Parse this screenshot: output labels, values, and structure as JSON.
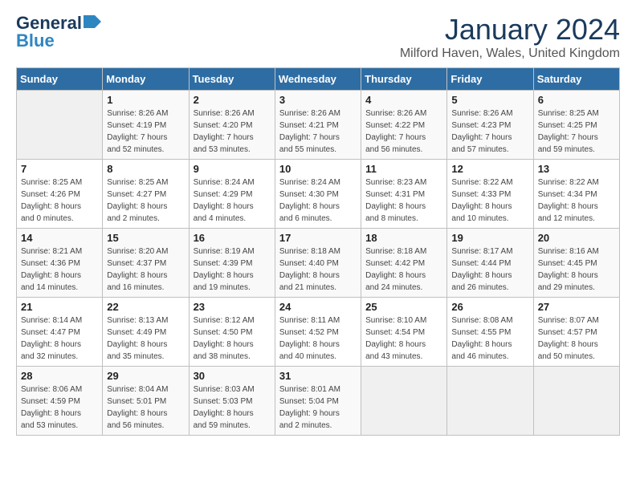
{
  "header": {
    "logo_line1": "General",
    "logo_line2": "Blue",
    "month": "January 2024",
    "location": "Milford Haven, Wales, United Kingdom"
  },
  "days_of_week": [
    "Sunday",
    "Monday",
    "Tuesday",
    "Wednesday",
    "Thursday",
    "Friday",
    "Saturday"
  ],
  "weeks": [
    [
      {
        "day": "",
        "info": ""
      },
      {
        "day": "1",
        "info": "Sunrise: 8:26 AM\nSunset: 4:19 PM\nDaylight: 7 hours\nand 52 minutes."
      },
      {
        "day": "2",
        "info": "Sunrise: 8:26 AM\nSunset: 4:20 PM\nDaylight: 7 hours\nand 53 minutes."
      },
      {
        "day": "3",
        "info": "Sunrise: 8:26 AM\nSunset: 4:21 PM\nDaylight: 7 hours\nand 55 minutes."
      },
      {
        "day": "4",
        "info": "Sunrise: 8:26 AM\nSunset: 4:22 PM\nDaylight: 7 hours\nand 56 minutes."
      },
      {
        "day": "5",
        "info": "Sunrise: 8:26 AM\nSunset: 4:23 PM\nDaylight: 7 hours\nand 57 minutes."
      },
      {
        "day": "6",
        "info": "Sunrise: 8:25 AM\nSunset: 4:25 PM\nDaylight: 7 hours\nand 59 minutes."
      }
    ],
    [
      {
        "day": "7",
        "info": "Sunrise: 8:25 AM\nSunset: 4:26 PM\nDaylight: 8 hours\nand 0 minutes."
      },
      {
        "day": "8",
        "info": "Sunrise: 8:25 AM\nSunset: 4:27 PM\nDaylight: 8 hours\nand 2 minutes."
      },
      {
        "day": "9",
        "info": "Sunrise: 8:24 AM\nSunset: 4:29 PM\nDaylight: 8 hours\nand 4 minutes."
      },
      {
        "day": "10",
        "info": "Sunrise: 8:24 AM\nSunset: 4:30 PM\nDaylight: 8 hours\nand 6 minutes."
      },
      {
        "day": "11",
        "info": "Sunrise: 8:23 AM\nSunset: 4:31 PM\nDaylight: 8 hours\nand 8 minutes."
      },
      {
        "day": "12",
        "info": "Sunrise: 8:22 AM\nSunset: 4:33 PM\nDaylight: 8 hours\nand 10 minutes."
      },
      {
        "day": "13",
        "info": "Sunrise: 8:22 AM\nSunset: 4:34 PM\nDaylight: 8 hours\nand 12 minutes."
      }
    ],
    [
      {
        "day": "14",
        "info": "Sunrise: 8:21 AM\nSunset: 4:36 PM\nDaylight: 8 hours\nand 14 minutes."
      },
      {
        "day": "15",
        "info": "Sunrise: 8:20 AM\nSunset: 4:37 PM\nDaylight: 8 hours\nand 16 minutes."
      },
      {
        "day": "16",
        "info": "Sunrise: 8:19 AM\nSunset: 4:39 PM\nDaylight: 8 hours\nand 19 minutes."
      },
      {
        "day": "17",
        "info": "Sunrise: 8:18 AM\nSunset: 4:40 PM\nDaylight: 8 hours\nand 21 minutes."
      },
      {
        "day": "18",
        "info": "Sunrise: 8:18 AM\nSunset: 4:42 PM\nDaylight: 8 hours\nand 24 minutes."
      },
      {
        "day": "19",
        "info": "Sunrise: 8:17 AM\nSunset: 4:44 PM\nDaylight: 8 hours\nand 26 minutes."
      },
      {
        "day": "20",
        "info": "Sunrise: 8:16 AM\nSunset: 4:45 PM\nDaylight: 8 hours\nand 29 minutes."
      }
    ],
    [
      {
        "day": "21",
        "info": "Sunrise: 8:14 AM\nSunset: 4:47 PM\nDaylight: 8 hours\nand 32 minutes."
      },
      {
        "day": "22",
        "info": "Sunrise: 8:13 AM\nSunset: 4:49 PM\nDaylight: 8 hours\nand 35 minutes."
      },
      {
        "day": "23",
        "info": "Sunrise: 8:12 AM\nSunset: 4:50 PM\nDaylight: 8 hours\nand 38 minutes."
      },
      {
        "day": "24",
        "info": "Sunrise: 8:11 AM\nSunset: 4:52 PM\nDaylight: 8 hours\nand 40 minutes."
      },
      {
        "day": "25",
        "info": "Sunrise: 8:10 AM\nSunset: 4:54 PM\nDaylight: 8 hours\nand 43 minutes."
      },
      {
        "day": "26",
        "info": "Sunrise: 8:08 AM\nSunset: 4:55 PM\nDaylight: 8 hours\nand 46 minutes."
      },
      {
        "day": "27",
        "info": "Sunrise: 8:07 AM\nSunset: 4:57 PM\nDaylight: 8 hours\nand 50 minutes."
      }
    ],
    [
      {
        "day": "28",
        "info": "Sunrise: 8:06 AM\nSunset: 4:59 PM\nDaylight: 8 hours\nand 53 minutes."
      },
      {
        "day": "29",
        "info": "Sunrise: 8:04 AM\nSunset: 5:01 PM\nDaylight: 8 hours\nand 56 minutes."
      },
      {
        "day": "30",
        "info": "Sunrise: 8:03 AM\nSunset: 5:03 PM\nDaylight: 8 hours\nand 59 minutes."
      },
      {
        "day": "31",
        "info": "Sunrise: 8:01 AM\nSunset: 5:04 PM\nDaylight: 9 hours\nand 2 minutes."
      },
      {
        "day": "",
        "info": ""
      },
      {
        "day": "",
        "info": ""
      },
      {
        "day": "",
        "info": ""
      }
    ]
  ]
}
